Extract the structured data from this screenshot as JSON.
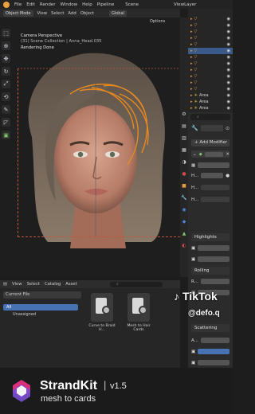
{
  "menu": {
    "items": [
      "File",
      "Edit",
      "Render",
      "Window",
      "Help",
      "Pipeline",
      "Scene"
    ],
    "view_layer": "ViewLayer"
  },
  "viewport_header": {
    "mode": "Object Mode",
    "menus": [
      "View",
      "Select",
      "Add",
      "Object"
    ],
    "orientation": "Global",
    "options": "Options"
  },
  "viewport": {
    "line1": "Camera Perspective",
    "line2": "(31) Scene Collection | Anna_Head.035",
    "line3": "Rendering Done"
  },
  "outliner": {
    "rows": [
      {
        "label": "",
        "selected": false
      },
      {
        "label": "",
        "selected": false
      },
      {
        "label": "",
        "selected": false
      },
      {
        "label": "",
        "selected": false
      },
      {
        "label": "",
        "selected": false
      },
      {
        "label": "",
        "selected": true
      },
      {
        "label": "",
        "selected": false
      },
      {
        "label": "",
        "selected": false
      },
      {
        "label": "",
        "selected": false
      },
      {
        "label": "",
        "selected": false
      },
      {
        "label": "",
        "selected": false
      },
      {
        "label": "",
        "selected": false
      },
      {
        "label": "Area",
        "selected": false
      },
      {
        "label": "Area",
        "selected": false
      },
      {
        "label": "Area",
        "selected": false
      }
    ]
  },
  "properties": {
    "add_modifier": "Add Modifier",
    "sections": {
      "highlights": "Highlights",
      "rolling": "Rolling",
      "scattering": "Scattering"
    },
    "row_labels": {
      "h1": "H...",
      "h2": "H...",
      "h3": "H...",
      "r1": "R...",
      "a1": "A..."
    }
  },
  "asset_browser": {
    "menus": [
      "View",
      "Select",
      "Catalog",
      "Asset"
    ],
    "library": "Current File",
    "catalog_all": "All",
    "catalog_unassigned": "Unassigned",
    "assets": [
      {
        "name": "Curve to Braid H..."
      },
      {
        "name": "Mesh to Hair Cards"
      }
    ]
  },
  "overlay": {
    "platform": "TikTok",
    "handle": "@defo.q"
  },
  "brand": {
    "name": "StrandKit",
    "separator": "|",
    "version": "v1.5",
    "tagline": "mesh to cards"
  },
  "colors": {
    "accent_orange": "#e8891f",
    "selection_blue": "#4772b3",
    "brand_pink": "#d9307a",
    "brand_purple": "#7a4fd6"
  }
}
